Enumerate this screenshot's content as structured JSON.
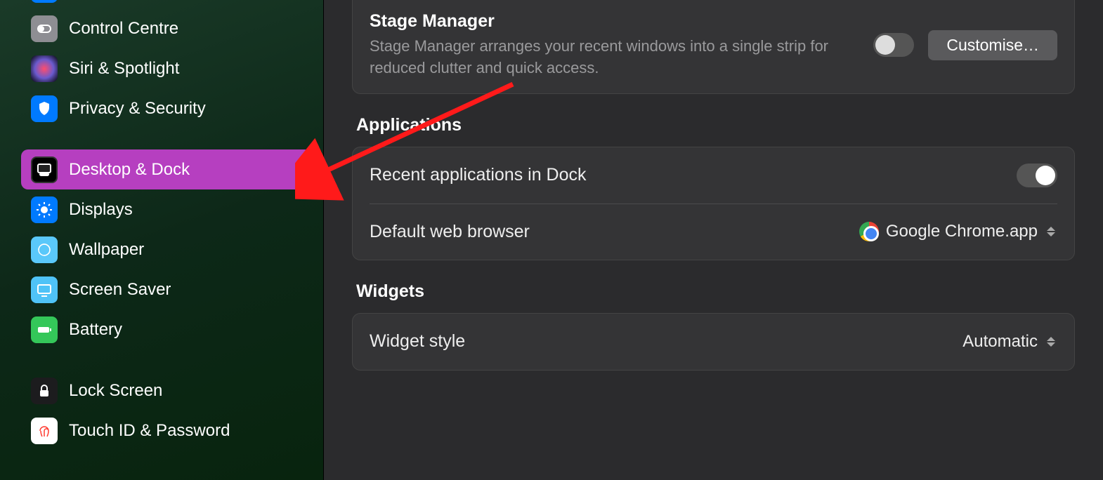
{
  "sidebar": {
    "items": [
      {
        "label": "Control Centre",
        "icon": "control-centre-icon"
      },
      {
        "label": "Siri & Spotlight",
        "icon": "siri-icon"
      },
      {
        "label": "Privacy & Security",
        "icon": "privacy-icon"
      },
      {
        "label": "Desktop & Dock",
        "icon": "desktop-dock-icon",
        "selected": true
      },
      {
        "label": "Displays",
        "icon": "displays-icon"
      },
      {
        "label": "Wallpaper",
        "icon": "wallpaper-icon"
      },
      {
        "label": "Screen Saver",
        "icon": "screensaver-icon"
      },
      {
        "label": "Battery",
        "icon": "battery-icon"
      },
      {
        "label": "Lock Screen",
        "icon": "lock-screen-icon"
      },
      {
        "label": "Touch ID & Password",
        "icon": "touchid-icon"
      }
    ]
  },
  "main": {
    "stage_manager": {
      "title": "Stage Manager",
      "description": "Stage Manager arranges your recent windows into a single strip for reduced clutter and quick access.",
      "enabled": false,
      "customise_label": "Customise…"
    },
    "sections": {
      "applications": {
        "title": "Applications",
        "recent_apps_label": "Recent applications in Dock",
        "recent_apps_enabled": true,
        "default_browser_label": "Default web browser",
        "default_browser_value": "Google Chrome.app"
      },
      "widgets": {
        "title": "Widgets",
        "style_label": "Widget style",
        "style_value": "Automatic"
      }
    }
  }
}
